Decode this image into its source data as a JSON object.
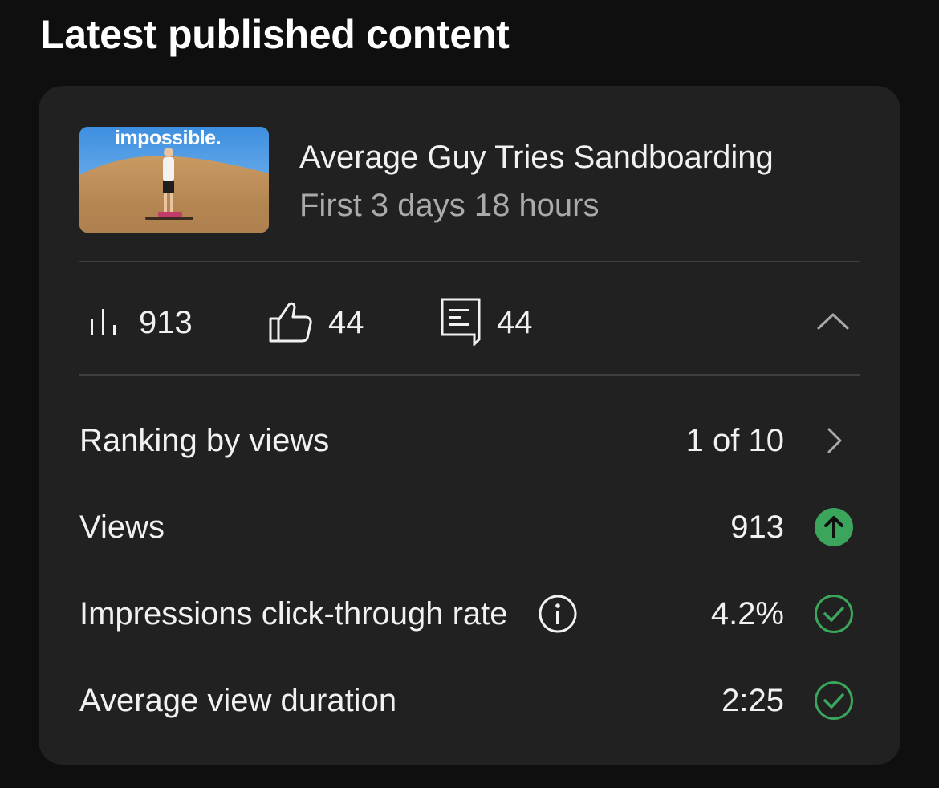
{
  "section": {
    "title": "Latest published content"
  },
  "video": {
    "thumbnail_text": "impossible.",
    "title": "Average Guy Tries Sandboarding",
    "subtitle": "First 3 days 18 hours"
  },
  "stats": [
    {
      "icon": "bar-chart-icon",
      "value": "913"
    },
    {
      "icon": "thumbs-up-icon",
      "value": "44"
    },
    {
      "icon": "comment-icon",
      "value": "44"
    }
  ],
  "metrics": [
    {
      "label": "Ranking by views",
      "value": "1 of 10",
      "indicator": "chevron-right-icon"
    },
    {
      "label": "Views",
      "value": "913",
      "indicator": "arrow-up-circle-icon"
    },
    {
      "label": "Impressions click-through rate",
      "value": "4.2%",
      "indicator": "check-circle-icon",
      "info": "info-icon"
    },
    {
      "label": "Average view duration",
      "value": "2:25",
      "indicator": "check-circle-icon"
    }
  ],
  "colors": {
    "background": "#0f0f0f",
    "card": "#212121",
    "accent_green": "#3ba55c",
    "divider": "#3f3f3f",
    "muted_text": "#aaaaaa"
  }
}
